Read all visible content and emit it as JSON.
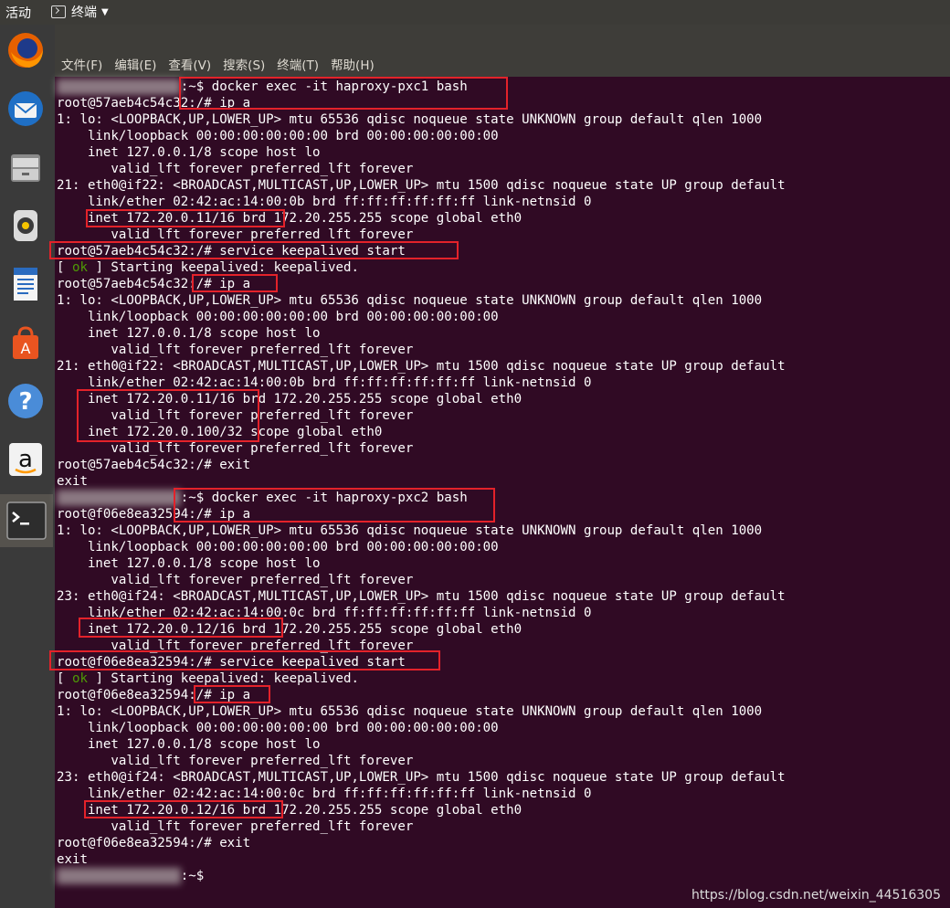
{
  "topbar": {
    "activities": "活动",
    "app_name": "终端"
  },
  "menu": [
    "文件(F)",
    "编辑(E)",
    "查看(V)",
    "搜索(S)",
    "终端(T)",
    "帮助(H)"
  ],
  "launcher": [
    {
      "icon": "firefox-icon"
    },
    {
      "icon": "thunderbird-mail-icon"
    },
    {
      "icon": "files-icon"
    },
    {
      "icon": "rhythmbox-icon"
    },
    {
      "icon": "libreoffice-writer-icon"
    },
    {
      "icon": "software-center-icon"
    },
    {
      "icon": "help-icon"
    },
    {
      "icon": "amazon-icon"
    },
    {
      "icon": "terminal-icon"
    }
  ],
  "lines": [
    {
      "segs": [
        {
          "t": "xxxxxxxxxxxxxxxx",
          "blur": true
        },
        {
          "t": ":~$ docker exec -it haproxy-pxc1 bash"
        }
      ]
    },
    {
      "segs": [
        {
          "t": "root@57aeb4c54c32:/# ip a"
        }
      ]
    },
    {
      "segs": [
        {
          "t": "1: lo: <LOOPBACK,UP,LOWER_UP> mtu 65536 qdisc noqueue state UNKNOWN group default qlen 1000"
        }
      ]
    },
    {
      "segs": [
        {
          "t": "    link/loopback 00:00:00:00:00:00 brd 00:00:00:00:00:00"
        }
      ]
    },
    {
      "segs": [
        {
          "t": "    inet 127.0.0.1/8 scope host lo"
        }
      ]
    },
    {
      "segs": [
        {
          "t": "       valid_lft forever preferred_lft forever"
        }
      ]
    },
    {
      "segs": [
        {
          "t": "21: eth0@if22: <BROADCAST,MULTICAST,UP,LOWER_UP> mtu 1500 qdisc noqueue state UP group default"
        }
      ]
    },
    {
      "segs": [
        {
          "t": "    link/ether 02:42:ac:14:00:0b brd ff:ff:ff:ff:ff:ff link-netnsid 0"
        }
      ]
    },
    {
      "segs": [
        {
          "t": "    inet 172.20.0.11/16 brd 172.20.255.255 scope global eth0"
        }
      ]
    },
    {
      "segs": [
        {
          "t": "       valid_lft forever preferred_lft forever"
        }
      ]
    },
    {
      "segs": [
        {
          "t": "root@57aeb4c54c32:/# service keepalived start"
        }
      ]
    },
    {
      "segs": [
        {
          "t": "[ "
        },
        {
          "t": "ok",
          "cls": "ok"
        },
        {
          "t": " ] Starting keepalived: keepalived."
        }
      ]
    },
    {
      "segs": [
        {
          "t": "root@57aeb4c54c32:/# ip a"
        }
      ]
    },
    {
      "segs": [
        {
          "t": "1: lo: <LOOPBACK,UP,LOWER_UP> mtu 65536 qdisc noqueue state UNKNOWN group default qlen 1000"
        }
      ]
    },
    {
      "segs": [
        {
          "t": "    link/loopback 00:00:00:00:00:00 brd 00:00:00:00:00:00"
        }
      ]
    },
    {
      "segs": [
        {
          "t": "    inet 127.0.0.1/8 scope host lo"
        }
      ]
    },
    {
      "segs": [
        {
          "t": "       valid_lft forever preferred_lft forever"
        }
      ]
    },
    {
      "segs": [
        {
          "t": "21: eth0@if22: <BROADCAST,MULTICAST,UP,LOWER_UP> mtu 1500 qdisc noqueue state UP group default"
        }
      ]
    },
    {
      "segs": [
        {
          "t": "    link/ether 02:42:ac:14:00:0b brd ff:ff:ff:ff:ff:ff link-netnsid 0"
        }
      ]
    },
    {
      "segs": [
        {
          "t": "    inet 172.20.0.11/16 brd 172.20.255.255 scope global eth0"
        }
      ]
    },
    {
      "segs": [
        {
          "t": "       valid_lft forever preferred_lft forever"
        }
      ]
    },
    {
      "segs": [
        {
          "t": "    inet 172.20.0.100/32 scope global eth0"
        }
      ]
    },
    {
      "segs": [
        {
          "t": "       valid_lft forever preferred_lft forever"
        }
      ]
    },
    {
      "segs": [
        {
          "t": "root@57aeb4c54c32:/# exit"
        }
      ]
    },
    {
      "segs": [
        {
          "t": "exit"
        }
      ]
    },
    {
      "segs": [
        {
          "t": "xxxxxxxxxxxxxxxx",
          "blur": true
        },
        {
          "t": ":~$ docker exec -it haproxy-pxc2 bash"
        }
      ]
    },
    {
      "segs": [
        {
          "t": "root@f06e8ea32594:/# ip a"
        }
      ]
    },
    {
      "segs": [
        {
          "t": "1: lo: <LOOPBACK,UP,LOWER_UP> mtu 65536 qdisc noqueue state UNKNOWN group default qlen 1000"
        }
      ]
    },
    {
      "segs": [
        {
          "t": "    link/loopback 00:00:00:00:00:00 brd 00:00:00:00:00:00"
        }
      ]
    },
    {
      "segs": [
        {
          "t": "    inet 127.0.0.1/8 scope host lo"
        }
      ]
    },
    {
      "segs": [
        {
          "t": "       valid_lft forever preferred_lft forever"
        }
      ]
    },
    {
      "segs": [
        {
          "t": "23: eth0@if24: <BROADCAST,MULTICAST,UP,LOWER_UP> mtu 1500 qdisc noqueue state UP group default"
        }
      ]
    },
    {
      "segs": [
        {
          "t": "    link/ether 02:42:ac:14:00:0c brd ff:ff:ff:ff:ff:ff link-netnsid 0"
        }
      ]
    },
    {
      "segs": [
        {
          "t": "    inet 172.20.0.12/16 brd 172.20.255.255 scope global eth0"
        }
      ]
    },
    {
      "segs": [
        {
          "t": "       valid_lft forever preferred_lft forever"
        }
      ]
    },
    {
      "segs": [
        {
          "t": "root@f06e8ea32594:/# service keepalived start"
        }
      ]
    },
    {
      "segs": [
        {
          "t": "[ "
        },
        {
          "t": "ok",
          "cls": "ok"
        },
        {
          "t": " ] Starting keepalived: keepalived."
        }
      ]
    },
    {
      "segs": [
        {
          "t": "root@f06e8ea32594:/# ip a"
        }
      ]
    },
    {
      "segs": [
        {
          "t": "1: lo: <LOOPBACK,UP,LOWER_UP> mtu 65536 qdisc noqueue state UNKNOWN group default qlen 1000"
        }
      ]
    },
    {
      "segs": [
        {
          "t": "    link/loopback 00:00:00:00:00:00 brd 00:00:00:00:00:00"
        }
      ]
    },
    {
      "segs": [
        {
          "t": "    inet 127.0.0.1/8 scope host lo"
        }
      ]
    },
    {
      "segs": [
        {
          "t": "       valid_lft forever preferred_lft forever"
        }
      ]
    },
    {
      "segs": [
        {
          "t": "23: eth0@if24: <BROADCAST,MULTICAST,UP,LOWER_UP> mtu 1500 qdisc noqueue state UP group default"
        }
      ]
    },
    {
      "segs": [
        {
          "t": "    link/ether 02:42:ac:14:00:0c brd ff:ff:ff:ff:ff:ff link-netnsid 0"
        }
      ]
    },
    {
      "segs": [
        {
          "t": "    inet 172.20.0.12/16 brd 172.20.255.255 scope global eth0"
        }
      ]
    },
    {
      "segs": [
        {
          "t": "       valid_lft forever preferred_lft forever"
        }
      ]
    },
    {
      "segs": [
        {
          "t": "root@f06e8ea32594:/# exit"
        }
      ]
    },
    {
      "segs": [
        {
          "t": "exit"
        }
      ]
    },
    {
      "segs": [
        {
          "t": "xxxxxxxxxxxxxxxx",
          "blur": true
        },
        {
          "t": ":~$ "
        }
      ]
    }
  ],
  "watermark": "https://blog.csdn.net/weixin_44516305",
  "colors": {
    "terminal_bg": "#300a24",
    "highlight_box": "#e3222a",
    "ok_green": "#4e9a06"
  }
}
